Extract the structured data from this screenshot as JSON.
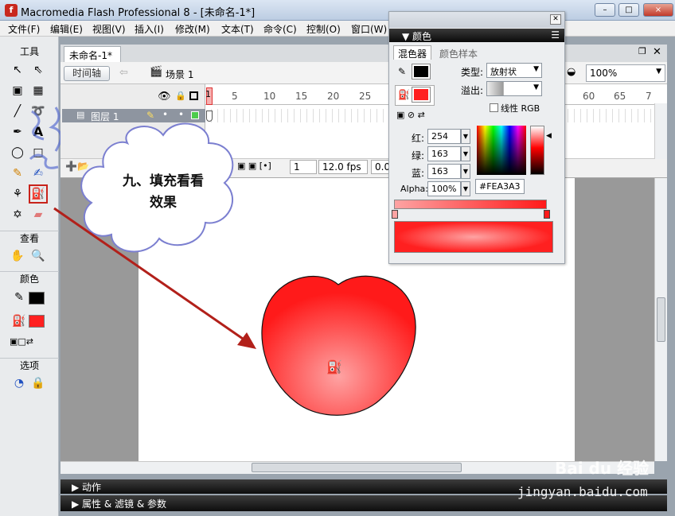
{
  "window": {
    "title": "Macromedia Flash Professional 8 - [未命名-1*]",
    "icon": "flash-app-icon",
    "controls": [
      "–",
      "□",
      "×"
    ]
  },
  "menu": [
    "文件(F)",
    "编辑(E)",
    "视图(V)",
    "插入(I)",
    "修改(M)",
    "文本(T)",
    "命令(C)",
    "控制(O)",
    "窗口(W)"
  ],
  "tools": {
    "header_tools": "工具",
    "header_view": "查看",
    "header_colors": "颜色",
    "header_options": "选项",
    "icons": [
      "selection-tool-icon",
      "subselection-tool-icon",
      "free-transform-tool-icon",
      "gradient-transform-tool-icon",
      "line-tool-icon",
      "lasso-tool-icon",
      "pen-tool-icon",
      "text-tool-icon",
      "oval-tool-icon",
      "rectangle-tool-icon",
      "pencil-tool-icon",
      "brush-tool-icon",
      "ink-bottle-icon",
      "paint-bucket-icon",
      "eyedropper-icon",
      "eraser-icon",
      "hand-tool-icon",
      "zoom-tool-icon"
    ]
  },
  "document": {
    "tab_label": "未命名-1*",
    "timeline_button": "时间轴",
    "scene_label": "场景 1",
    "zoom": "100%"
  },
  "timeline": {
    "layer_name": "图层 1",
    "frame_numbers": [
      "1",
      "5",
      "10",
      "15",
      "20",
      "25",
      "60",
      "65",
      "7"
    ],
    "current_frame": "1",
    "fps": "12.0 fps",
    "elapsed": "0.0"
  },
  "color_panel": {
    "title": "颜色",
    "tab_mixer": "混色器",
    "tab_swatches": "颜色样本",
    "type_label": "类型:",
    "type_value": "放射状",
    "overflow_label": "溢出:",
    "linear_rgb_label": "线性 RGB",
    "red_label": "红:",
    "red_value": "254",
    "green_label": "绿:",
    "green_value": "163",
    "blue_label": "蓝:",
    "blue_value": "163",
    "alpha_label": "Alpha:",
    "alpha_value": "100%",
    "hex_value": "#FEA3A3",
    "stroke_color": "#000000",
    "fill_color": "#ff2020"
  },
  "callout": {
    "line1": "九、填充看看",
    "line2": "效果"
  },
  "bottom_panels": {
    "actions": "动作",
    "properties": "属性 & 滤镜 & 参数"
  },
  "watermark": {
    "brand": "Bai du 经验",
    "url": "jingyan.baidu.com"
  },
  "colors": {
    "accent_red": "#c8231b",
    "shape_center": "#fea3a3",
    "shape_edge": "#ff1a1a"
  }
}
